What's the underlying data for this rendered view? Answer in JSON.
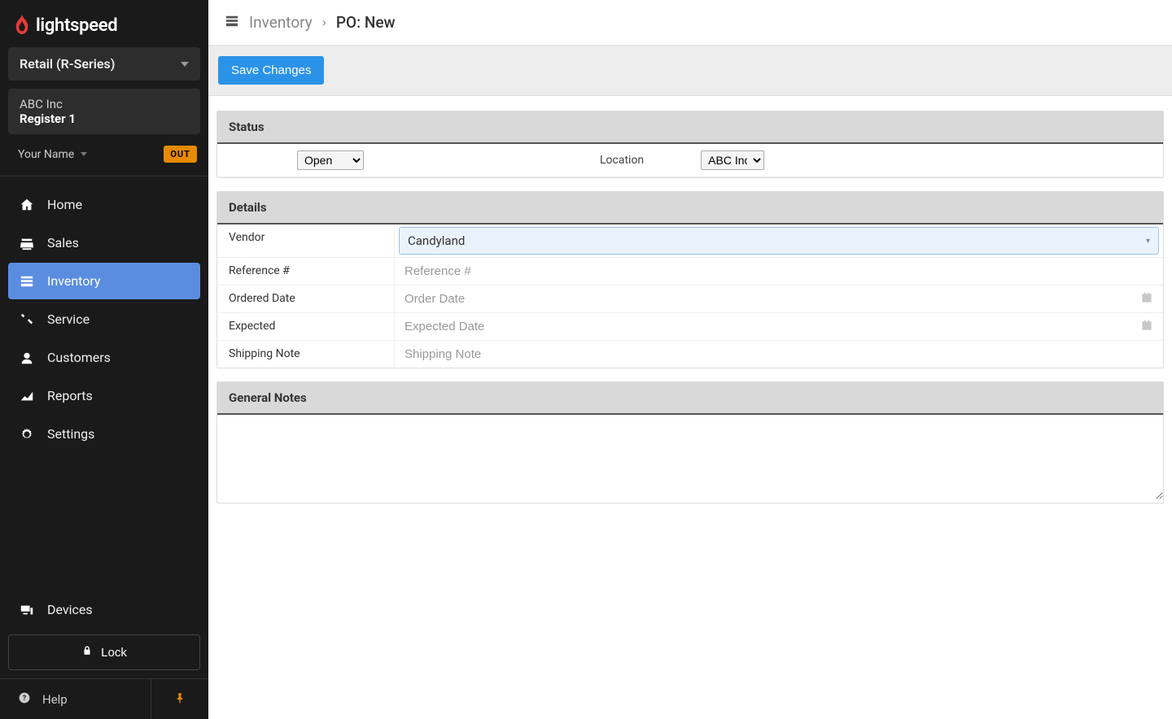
{
  "brand": {
    "name": "lightspeed"
  },
  "sidebar": {
    "product_line": "Retail (R-Series)",
    "company": "ABC Inc",
    "register": "Register 1",
    "user_name": "Your Name",
    "out_badge": "OUT",
    "nav": [
      {
        "label": "Home"
      },
      {
        "label": "Sales"
      },
      {
        "label": "Inventory"
      },
      {
        "label": "Service"
      },
      {
        "label": "Customers"
      },
      {
        "label": "Reports"
      },
      {
        "label": "Settings"
      }
    ],
    "devices": "Devices",
    "lock": "Lock",
    "help": "Help"
  },
  "breadcrumb": {
    "section": "Inventory",
    "current": "PO: New"
  },
  "actions": {
    "save": "Save Changes"
  },
  "panels": {
    "status": {
      "header": "Status",
      "open_value": "Open",
      "location_label": "Location",
      "location_value": "ABC Inc"
    },
    "details": {
      "header": "Details",
      "fields": {
        "vendor": {
          "label": "Vendor",
          "value": "Candyland"
        },
        "reference": {
          "label": "Reference #",
          "placeholder": "Reference #"
        },
        "ordered": {
          "label": "Ordered Date",
          "placeholder": "Order Date"
        },
        "expected": {
          "label": "Expected",
          "placeholder": "Expected Date"
        },
        "shipping_note": {
          "label": "Shipping Note",
          "placeholder": "Shipping Note"
        }
      }
    },
    "general_notes": {
      "header": "General Notes",
      "value": ""
    }
  }
}
